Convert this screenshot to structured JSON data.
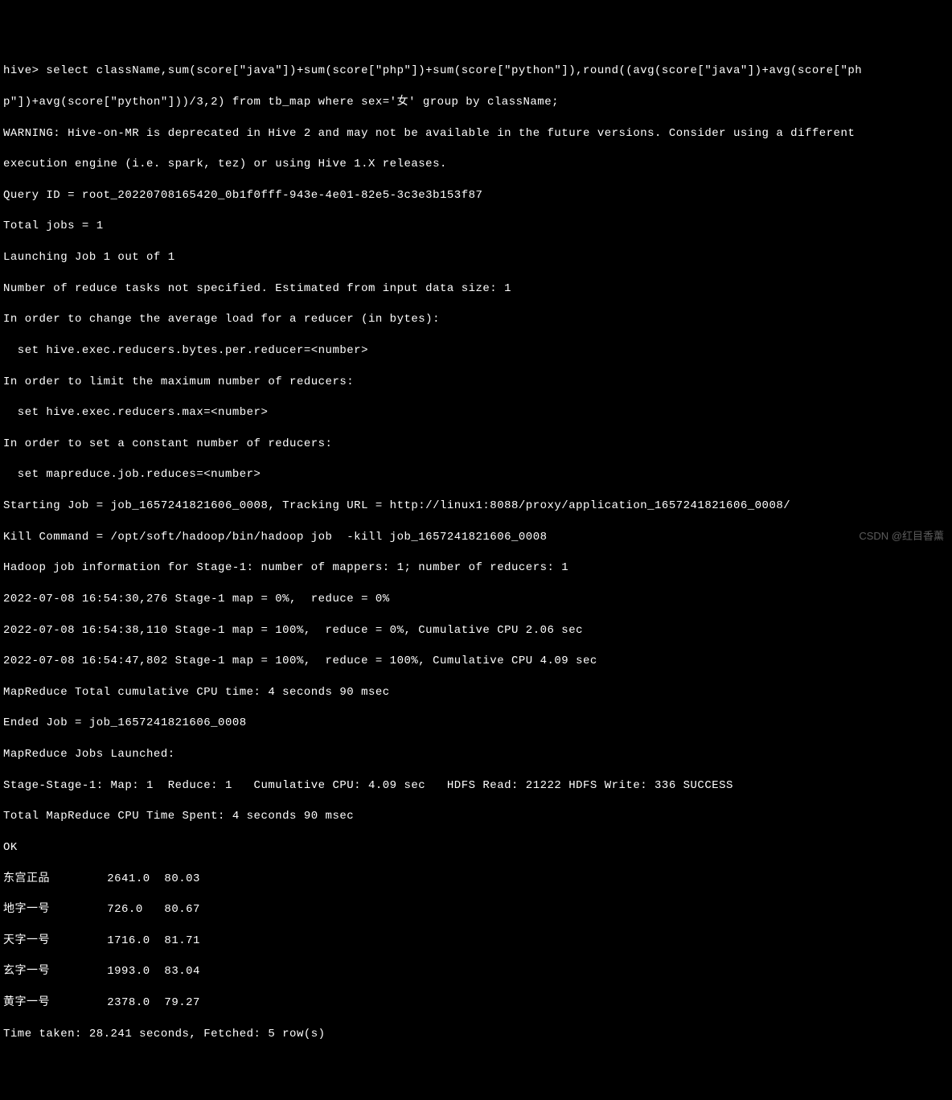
{
  "prompt_line1": "hive> select className,sum(score[\"java\"])+sum(score[\"php\"])+sum(score[\"python\"]),round((avg(score[\"java\"])+avg(score[\"ph",
  "prompt_line2": "p\"])+avg(score[\"python\"]))/3,2) from tb_map where sex='女' group by className;",
  "warning_line1": "WARNING: Hive-on-MR is deprecated in Hive 2 and may not be available in the future versions. Consider using a different ",
  "warning_line2": "execution engine (i.e. spark, tez) or using Hive 1.X releases.",
  "query_id": "Query ID = root_20220708165420_0b1f0fff-943e-4e01-82e5-3c3e3b153f87",
  "total_jobs": "Total jobs = 1",
  "launching": "Launching Job 1 out of 1",
  "reduce_tasks": "Number of reduce tasks not specified. Estimated from input data size: 1",
  "change_avg": "In order to change the average load for a reducer (in bytes):",
  "set_bytes": "  set hive.exec.reducers.bytes.per.reducer=<number>",
  "limit_max": "In order to limit the maximum number of reducers:",
  "set_max": "  set hive.exec.reducers.max=<number>",
  "set_const": "In order to set a constant number of reducers:",
  "set_reduces": "  set mapreduce.job.reduces=<number>",
  "starting_job": "Starting Job = job_1657241821606_0008, Tracking URL = http://linux1:8088/proxy/application_1657241821606_0008/",
  "kill_cmd": "Kill Command = /opt/soft/hadoop/bin/hadoop job  -kill job_1657241821606_0008",
  "hadoop_info": "Hadoop job information for Stage-1: number of mappers: 1; number of reducers: 1",
  "progress1": "2022-07-08 16:54:30,276 Stage-1 map = 0%,  reduce = 0%",
  "progress2": "2022-07-08 16:54:38,110 Stage-1 map = 100%,  reduce = 0%, Cumulative CPU 2.06 sec",
  "progress3": "2022-07-08 16:54:47,802 Stage-1 map = 100%,  reduce = 100%, Cumulative CPU 4.09 sec",
  "mr_total": "MapReduce Total cumulative CPU time: 4 seconds 90 msec",
  "ended_job": "Ended Job = job_1657241821606_0008",
  "mr_launched": "MapReduce Jobs Launched:",
  "stage_summary": "Stage-Stage-1: Map: 1  Reduce: 1   Cumulative CPU: 4.09 sec   HDFS Read: 21222 HDFS Write: 336 SUCCESS",
  "total_cpu": "Total MapReduce CPU Time Spent: 4 seconds 90 msec",
  "ok": "OK",
  "results": [
    "东宫正品        2641.0  80.03",
    "地字一号        726.0   80.67",
    "天字一号        1716.0  81.71",
    "玄字一号        1993.0  83.04",
    "黄字一号        2378.0  79.27"
  ],
  "time_taken": "Time taken: 28.241 seconds, Fetched: 5 row(s)",
  "watermark": "CSDN @红目香薰"
}
